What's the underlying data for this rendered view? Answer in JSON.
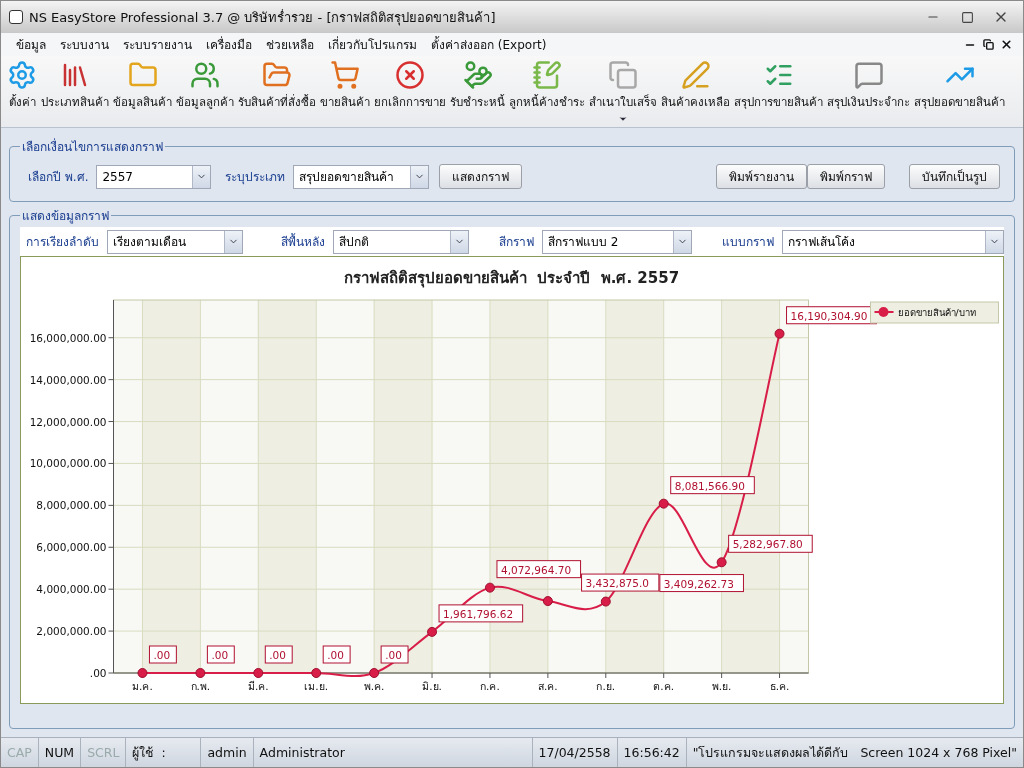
{
  "window": {
    "title": "NS EasyStore Professional 3.7 @ บริษัทร่ำรวย - [กราฟสถิติสรุปยอดขายสินค้า]"
  },
  "menu": [
    "ข้อมูล",
    "ระบบงาน",
    "ระบบรายงาน",
    "เครื่องมือ",
    "ช่วยเหลือ",
    "เกี่ยวกับโปรแกรม",
    "ตั้งค่าส่งออก (Export)"
  ],
  "toolbar": [
    {
      "label": "ตั้งค่า",
      "has_menu": false
    },
    {
      "label": "ประเภทสินค้า",
      "has_menu": false
    },
    {
      "label": "ข้อมูลสินค้า",
      "has_menu": false
    },
    {
      "label": "ข้อมูลลูกค้า",
      "has_menu": false
    },
    {
      "label": "รับสินค้าที่สั่งซื้อ",
      "has_menu": false
    },
    {
      "label": "ขายสินค้า",
      "has_menu": false
    },
    {
      "label": "ยกเลิกการขาย",
      "has_menu": false
    },
    {
      "label": "รับชำระหนี้",
      "has_menu": false
    },
    {
      "label": "ลูกหนี้ค้างชำระ",
      "has_menu": false
    },
    {
      "label": "สำเนาใบเสร็จ",
      "has_menu": true
    },
    {
      "label": "สินค้าคงเหลือ",
      "has_menu": false
    },
    {
      "label": "สรุปการขายสินค้า",
      "has_menu": false
    },
    {
      "label": "สรุปเงินประจำกะ",
      "has_menu": false
    },
    {
      "label": "สรุปยอดขายสินค้า",
      "has_menu": false
    }
  ],
  "options_group": {
    "title": "เลือกเงื่อนไขการแสดงกราฟ",
    "fields": [
      {
        "label": "เลือกปี พ.ศ.",
        "value": "2557"
      },
      {
        "label": "ระบุประเภท",
        "value": "สรุปยอดขายสินค้า"
      }
    ],
    "show_button": "แสดงกราฟ",
    "right_buttons": [
      "พิมพ์รายงาน",
      "พิมพ์กราฟ",
      "บันทึกเป็นรูป"
    ]
  },
  "graph_group": {
    "title": "แสดงข้อมูลกราฟ",
    "fields": [
      {
        "label": "การเรียงลำดับ",
        "value": "เรียงตามเดือน"
      },
      {
        "label": "สีพื้นหลัง",
        "value": "สีปกติ"
      },
      {
        "label": "สีกราฟ",
        "value": "สีกราฟแบบ 2"
      },
      {
        "label": "แบบกราฟ",
        "value": "กราฟเส้นโค้ง"
      }
    ],
    "chart_data": {
      "type": "line",
      "title": "กราฟสถิติสรุปยอดขายสินค้า  ประจำปี  พ.ศ. 2557",
      "categories": [
        "ม.ค.",
        "ก.พ.",
        "มี.ค.",
        "เม.ย.",
        "พ.ค.",
        "มิ.ย.",
        "ก.ค.",
        "ส.ค.",
        "ก.ย.",
        "ต.ค.",
        "พ.ย.",
        "ธ.ค."
      ],
      "series": [
        {
          "name": "ยอดขายสินค้า/บาท",
          "color": "#d81e48",
          "marker": "circle",
          "values": [
            0,
            0,
            0,
            0,
            0,
            1961796.62,
            4072964.7,
            3432875.0,
            3409262.73,
            8081566.9,
            5282967.8,
            16190304.9
          ]
        }
      ],
      "value_labels": [
        ".00",
        ".00",
        ".00",
        ".00",
        ".00",
        "1,961,796.62",
        "4,072,964.70",
        "3,432,875.0",
        "3,409,262.73",
        "8,081,566.90",
        "5,282,967.80",
        "16,190,304.90"
      ],
      "ylim": [
        0,
        17800000
      ],
      "grid": true,
      "yticks": [
        {
          "value": 0,
          "label": ".00"
        },
        {
          "value": 2000000,
          "label": "2,000,000.00"
        },
        {
          "value": 4000000,
          "label": "4,000,000.00"
        },
        {
          "value": 6000000,
          "label": "6,000,000.00"
        },
        {
          "value": 8000000,
          "label": "8,000,000.00"
        },
        {
          "value": 10000000,
          "label": "10,000,000.00"
        },
        {
          "value": 12000000,
          "label": "12,000,000.00"
        },
        {
          "value": 14000000,
          "label": "14,000,000.00"
        },
        {
          "value": 16000000,
          "label": "16,000,000.00"
        }
      ]
    }
  },
  "status_bar": {
    "keys": [
      {
        "label": "CAP",
        "on": false
      },
      {
        "label": "NUM",
        "on": true
      },
      {
        "label": "SCRL",
        "on": false
      }
    ],
    "user_label": "ผู้ใช้  :",
    "user": "admin",
    "role": "Administrator",
    "date": "17/04/2558",
    "time": "16:56:42",
    "message": "\"โปรแกรมจะแสดงผลได้ดีกับ   Screen 1024 x 768 Pixel\""
  }
}
